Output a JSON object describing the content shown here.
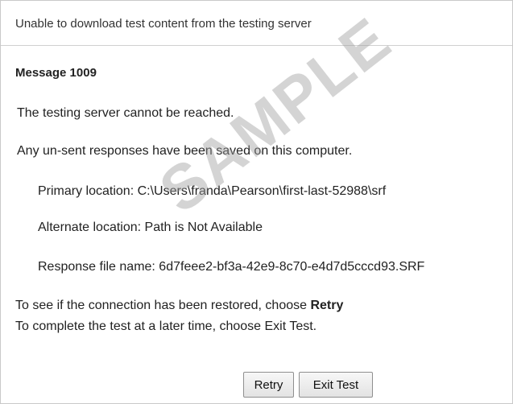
{
  "dialog": {
    "title": "Unable to download test content from the testing server",
    "heading": "Message 1009",
    "server_unreachable": "The testing server cannot be reached.",
    "saved_notice": "Any un-sent responses have been saved on this computer.",
    "primary_location": "Primary location: C:\\Users\\franda\\Pearson\\first-last-52988\\srf",
    "alternate_location": "Alternate location: Path is Not Available",
    "response_file": "Response file name: 6d7feee2-bf3a-42e9-8c70-e4d7d5cccd93.SRF",
    "retry_instruction_prefix": "To see if the connection has been restored, choose ",
    "retry_instruction_strong": "Retry",
    "exit_instruction": "To complete the test at a later time, choose Exit Test.",
    "watermark": "SAMPLE"
  },
  "buttons": {
    "retry_label": "Retry",
    "exit_label": "Exit Test"
  }
}
